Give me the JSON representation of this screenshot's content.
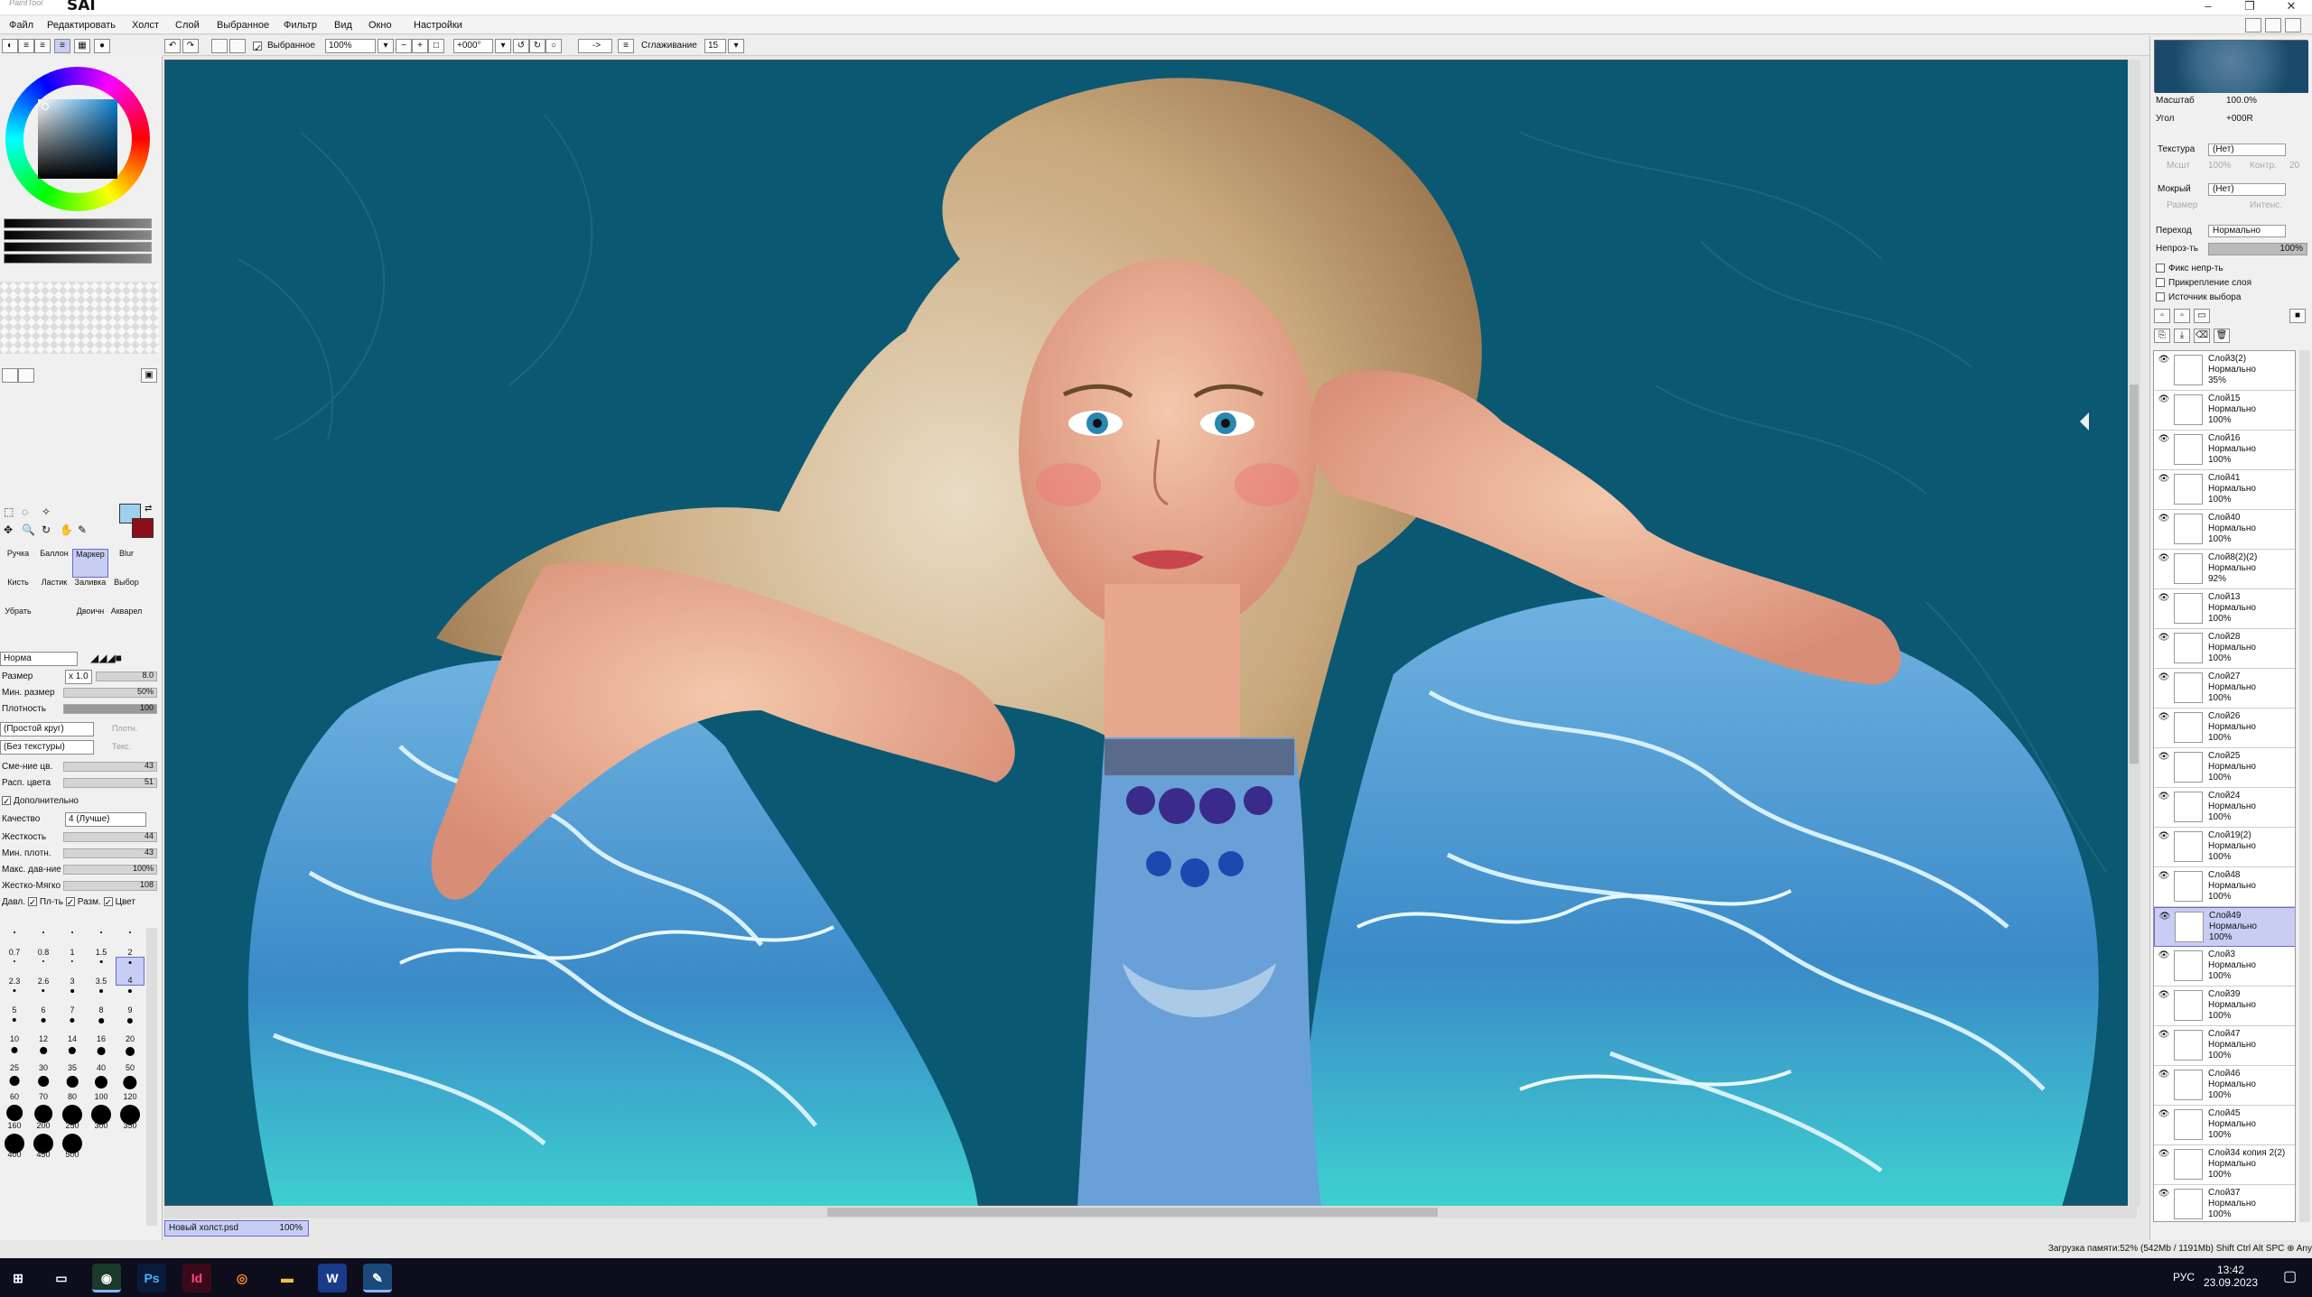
{
  "app": {
    "logo_small": "PaintTool",
    "logo_big": "SAI",
    "window_controls": [
      "–",
      "❐",
      "✕"
    ]
  },
  "menu": [
    "Файл",
    "Редактировать",
    "Холст",
    "Слой",
    "Выбранное",
    "Фильтр",
    "Вид",
    "Окно",
    "Настройки"
  ],
  "toolbar": {
    "selected_label": "Выбранное",
    "zoom": "100%",
    "angle": "+000°",
    "arrow": "->",
    "smoothing_label": "Сглаживание",
    "smoothing_value": "15"
  },
  "tools": {
    "brushes": [
      {
        "label": "Ручка",
        "selected": false
      },
      {
        "label": "Баллон",
        "selected": false
      },
      {
        "label": "Маркер",
        "selected": true
      },
      {
        "label": "Blur",
        "selected": false
      },
      {
        "label": "Кисть",
        "selected": false
      },
      {
        "label": "Ластик",
        "selected": false
      },
      {
        "label": "Заливка",
        "selected": false
      },
      {
        "label": "Выбор",
        "selected": false
      },
      {
        "label": "Убрать",
        "selected": false
      },
      {
        "label": "",
        "selected": false
      },
      {
        "label": "Двоичн",
        "selected": false
      },
      {
        "label": "Акварел",
        "selected": false
      }
    ],
    "mode": "Норма"
  },
  "brush_props": {
    "size_label": "Размер",
    "size_mult": "x 1.0",
    "size_value": "8.0",
    "min_size_label": "Мин. размер",
    "min_size_value": "50%",
    "density_label": "Плотность",
    "density_value": "100",
    "shape": "(Простой круг)",
    "shape_val": "Плотн.",
    "texture": "(Без текстуры)",
    "texture_val": "Текс.",
    "blend_label": "Сме-ние цв.",
    "blend_value": "43",
    "dilution_label": "Расп. цвета",
    "dilution_value": "51",
    "advanced_label": "Дополнительно",
    "quality_label": "Качество",
    "quality_value": "4 (Лучше)",
    "hardness_label": "Жесткость",
    "hardness_value": "44",
    "min_density_label": "Мин. плотн.",
    "min_density_value": "43",
    "max_pressure_label": "Макс. дав-ние",
    "max_pressure_value": "100%",
    "hard_soft_label": "Жестко-Мягко",
    "hard_soft_value": "108",
    "pressure_label": "Давл.",
    "pressure_density": "Пл-ть",
    "pressure_size": "Разм.",
    "pressure_color": "Цвет"
  },
  "brush_sizes": [
    "0.7",
    "0.8",
    "1",
    "1.5",
    "2",
    "2.3",
    "2.6",
    "3",
    "3.5",
    "4",
    "5",
    "6",
    "7",
    "8",
    "9",
    "10",
    "12",
    "14",
    "16",
    "20",
    "25",
    "30",
    "35",
    "40",
    "50",
    "60",
    "70",
    "80",
    "100",
    "120",
    "160",
    "200",
    "250",
    "300",
    "350",
    "400",
    "450",
    "500"
  ],
  "canvas": {
    "document_name": "Новый холст.psd",
    "document_zoom": "100%"
  },
  "navigator": {
    "zoom_label": "Масштаб",
    "zoom_value": "100.0%",
    "angle_label": "Угол",
    "angle_value": "+000R"
  },
  "layer_props": {
    "texture_label": "Текстура",
    "texture_value": "(Нет)",
    "scale_label": "Мсшт",
    "scale_value": "100%",
    "contrast_label": "Контр.",
    "contrast_value": "20",
    "wet_label": "Мокрый",
    "wet_value": "(Нет)",
    "size_label": "Размер",
    "size_value": "",
    "intensity_label": "Интенс.",
    "intensity_value": "",
    "mode_label": "Переход",
    "mode_value": "Нормально",
    "opacity_label": "Непроз-ть",
    "opacity_value": "100%",
    "opt1": "Фикс непр-ть",
    "opt2": "Прикрепление слоя",
    "opt3": "Источник выбора"
  },
  "layers": [
    {
      "name": "Слой3(2)",
      "mode": "Нормально",
      "opacity": "35%",
      "selected": false
    },
    {
      "name": "Слой15",
      "mode": "Нормально",
      "opacity": "100%",
      "selected": false
    },
    {
      "name": "Слой16",
      "mode": "Нормально",
      "opacity": "100%",
      "selected": false
    },
    {
      "name": "Слой41",
      "mode": "Нормально",
      "opacity": "100%",
      "selected": false
    },
    {
      "name": "Слой40",
      "mode": "Нормально",
      "opacity": "100%",
      "selected": false
    },
    {
      "name": "Слой8(2)(2)",
      "mode": "Нормально",
      "opacity": "92%",
      "selected": false
    },
    {
      "name": "Слой13",
      "mode": "Нормально",
      "opacity": "100%",
      "selected": false
    },
    {
      "name": "Слой28",
      "mode": "Нормально",
      "opacity": "100%",
      "selected": false
    },
    {
      "name": "Слой27",
      "mode": "Нормально",
      "opacity": "100%",
      "selected": false
    },
    {
      "name": "Слой26",
      "mode": "Нормально",
      "opacity": "100%",
      "selected": false
    },
    {
      "name": "Слой25",
      "mode": "Нормально",
      "opacity": "100%",
      "selected": false
    },
    {
      "name": "Слой24",
      "mode": "Нормально",
      "opacity": "100%",
      "selected": false
    },
    {
      "name": "Слой19(2)",
      "mode": "Нормально",
      "opacity": "100%",
      "selected": false
    },
    {
      "name": "Слой48",
      "mode": "Нормально",
      "opacity": "100%",
      "selected": false
    },
    {
      "name": "Слой49",
      "mode": "Нормально",
      "opacity": "100%",
      "selected": true
    },
    {
      "name": "Слой3",
      "mode": "Нормально",
      "opacity": "100%",
      "selected": false
    },
    {
      "name": "Слой39",
      "mode": "Нормально",
      "opacity": "100%",
      "selected": false
    },
    {
      "name": "Слой47",
      "mode": "Нормально",
      "opacity": "100%",
      "selected": false
    },
    {
      "name": "Слой46",
      "mode": "Нормально",
      "opacity": "100%",
      "selected": false
    },
    {
      "name": "Слой45",
      "mode": "Нормально",
      "opacity": "100%",
      "selected": false
    },
    {
      "name": "Слой34 копия 2(2)",
      "mode": "Нормально",
      "opacity": "100%",
      "selected": false
    },
    {
      "name": "Слой37",
      "mode": "Нормально",
      "opacity": "100%",
      "selected": false
    }
  ],
  "status": {
    "memory": "Загрузка памяти:52% (542Mb / 1191Mb)",
    "keys": "Shift Ctrl Alt SPC ⊕ Any"
  },
  "taskbar": {
    "apps": [
      "start-icon",
      "taskview-icon",
      "chrome-icon",
      "photoshop-icon",
      "indesign-icon",
      "firefox-icon",
      "explorer-icon",
      "word-icon",
      "sai-icon"
    ],
    "lang": "РУС",
    "time": "13:42",
    "date": "23.09.2023"
  },
  "colors": {
    "canvas_bg": "#0b5873",
    "fg_swatch": "#9ed0ee",
    "bg_swatch": "#8a0f1a",
    "selection": "#c8cdf4"
  }
}
